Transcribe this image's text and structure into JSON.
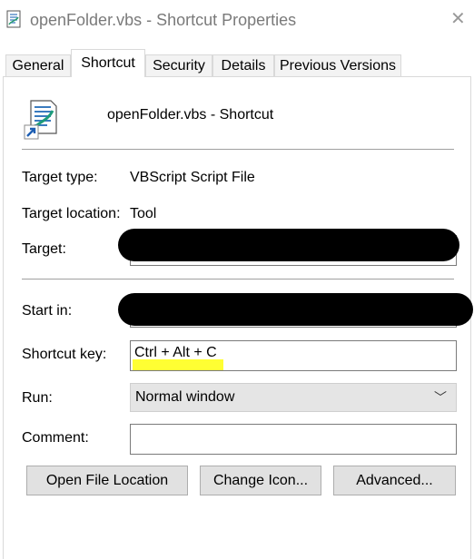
{
  "window": {
    "title": "openFolder.vbs - Shortcut Properties",
    "close_glyph": "✕"
  },
  "tabs": [
    {
      "label": "General",
      "active": false
    },
    {
      "label": "Shortcut",
      "active": true
    },
    {
      "label": "Security",
      "active": false
    },
    {
      "label": "Details",
      "active": false
    },
    {
      "label": "Previous Versions",
      "active": false
    }
  ],
  "header": {
    "name": "openFolder.vbs - Shortcut",
    "icon": "vbscript-shortcut-icon"
  },
  "fields": {
    "target_type": {
      "label": "Target type:",
      "value": "VBScript Script File"
    },
    "target_location": {
      "label": "Target location:",
      "value": "Tool"
    },
    "target": {
      "label": "Target:",
      "value": ""
    },
    "start_in": {
      "label": "Start in:",
      "value": ""
    },
    "shortcut_key": {
      "label": "Shortcut key:",
      "value": "Ctrl + Alt + C"
    },
    "run": {
      "label": "Run:",
      "value": "Normal window"
    },
    "comment": {
      "label": "Comment:",
      "value": ""
    }
  },
  "buttons": {
    "open_file_location": "Open File Location",
    "change_icon": "Change Icon...",
    "advanced": "Advanced..."
  },
  "colors": {
    "highlight": "#ffff33",
    "redaction": "#000000"
  }
}
